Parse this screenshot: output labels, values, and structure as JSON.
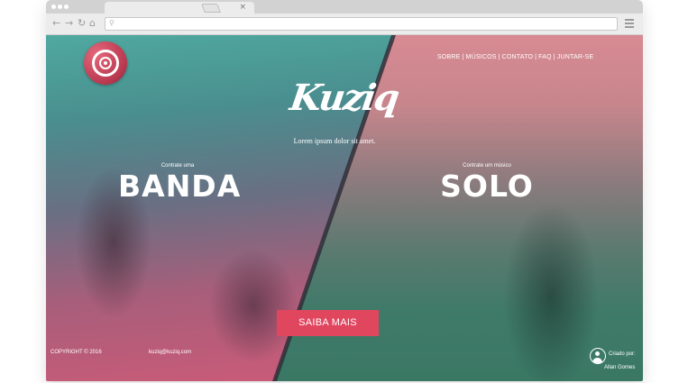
{
  "browser": {
    "tab_close": "×",
    "nav_back": "←",
    "nav_forward": "→",
    "nav_reload": "↻",
    "nav_home": "⌂",
    "url_search_icon": "⚲"
  },
  "site": {
    "nav": [
      "SOBRE",
      "MÚSICOS",
      "CONTATO",
      "FAQ",
      "JUNTAR-SE"
    ],
    "nav_separator": "|",
    "brand": "Kuziq",
    "tagline": "Lorem ipsum dolor sit amet.",
    "left": {
      "label": "Contrate uma",
      "word": "BANDA"
    },
    "right": {
      "label": "Contrate um músico",
      "word": "SOLO"
    },
    "cta": "SAIBA MAIS",
    "footer": {
      "copyright": "COPYRIGHT © 2016",
      "email": "kuziq@kuziq.com",
      "credit_label": "Criado por:",
      "credit_name": "Allan Gomes"
    }
  },
  "colors": {
    "accent": "#e1465f",
    "left_top": "#4fa9a0",
    "left_bottom": "#d35a78",
    "right_top": "#d88a93",
    "right_bottom": "#3a7864"
  },
  "icons": {
    "logo": "vinyl-disc-icon",
    "author": "user-avatar-icon",
    "menu": "hamburger-menu-icon"
  }
}
